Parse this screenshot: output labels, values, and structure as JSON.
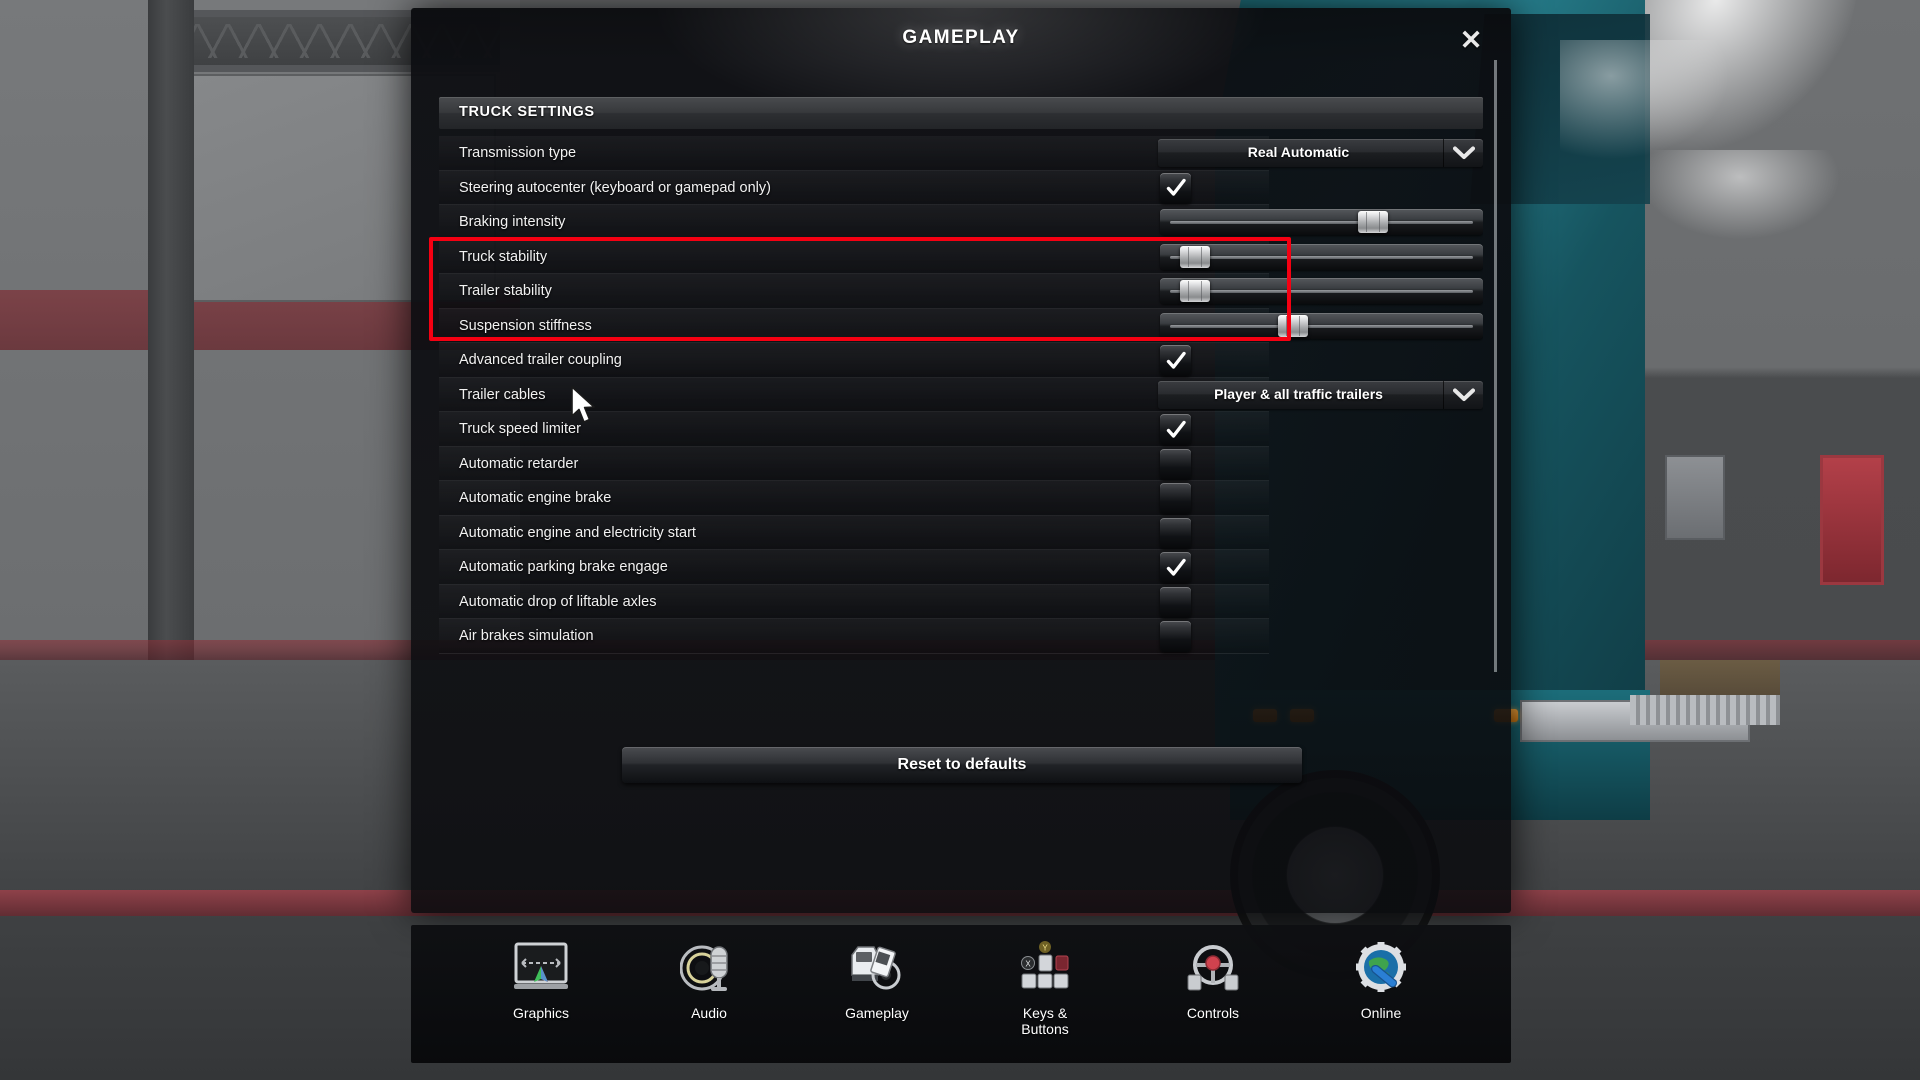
{
  "dialog": {
    "title": "GAMEPLAY",
    "close_label": "✕",
    "section_header": "TRUCK SETTINGS",
    "reset_button": "Reset to defaults"
  },
  "settings": [
    {
      "label": "Transmission type",
      "control": "dropdown",
      "value": "Real Automatic",
      "highlighted": false
    },
    {
      "label": "Steering autocenter (keyboard or gamepad only)",
      "control": "checkbox",
      "checked": true,
      "highlighted": false
    },
    {
      "label": "Braking intensity",
      "control": "slider",
      "percent": 68,
      "highlighted": false
    },
    {
      "label": "Truck stability",
      "control": "slider",
      "percent": 6,
      "highlighted": true
    },
    {
      "label": "Trailer stability",
      "control": "slider",
      "percent": 6,
      "highlighted": true
    },
    {
      "label": "Suspension stiffness",
      "control": "slider",
      "percent": 40,
      "highlighted": true
    },
    {
      "label": "Advanced trailer coupling",
      "control": "checkbox",
      "checked": true,
      "highlighted": false
    },
    {
      "label": "Trailer cables",
      "control": "dropdown",
      "value": "Player & all traffic trailers",
      "highlighted": false
    },
    {
      "label": "Truck speed limiter",
      "control": "checkbox",
      "checked": true,
      "highlighted": false
    },
    {
      "label": "Automatic retarder",
      "control": "checkbox",
      "checked": false,
      "highlighted": false
    },
    {
      "label": "Automatic engine brake",
      "control": "checkbox",
      "checked": false,
      "highlighted": false
    },
    {
      "label": "Automatic engine and electricity start",
      "control": "checkbox",
      "checked": false,
      "highlighted": false
    },
    {
      "label": "Automatic parking brake engage",
      "control": "checkbox",
      "checked": true,
      "highlighted": false
    },
    {
      "label": "Automatic drop of liftable axles",
      "control": "checkbox",
      "checked": false,
      "highlighted": false
    },
    {
      "label": "Air brakes simulation",
      "control": "checkbox",
      "checked": false,
      "highlighted": false
    }
  ],
  "tabs": [
    {
      "label": "Graphics",
      "icon": "monitor-icon",
      "active": false
    },
    {
      "label": "Audio",
      "icon": "microphone-icon",
      "active": false
    },
    {
      "label": "Gameplay",
      "icon": "truck-icon",
      "active": true
    },
    {
      "label": "Keys &\nButtons",
      "icon": "keyboard-keys-icon",
      "active": false
    },
    {
      "label": "Controls",
      "icon": "steering-wheel-icon",
      "active": false
    },
    {
      "label": "Online",
      "icon": "globe-gear-icon",
      "active": false
    }
  ],
  "colors": {
    "highlight_red": "#f50012",
    "text_primary": "#f2f2f2",
    "panel_bg": "#0a0b0e"
  }
}
